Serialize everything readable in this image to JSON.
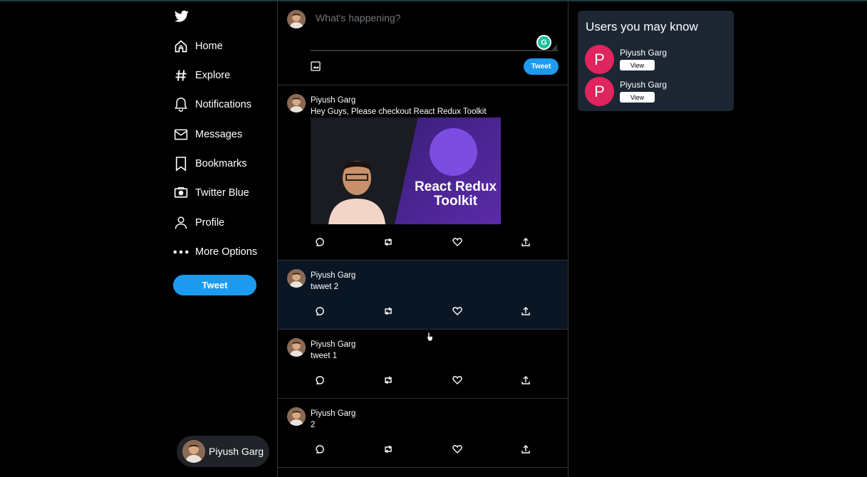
{
  "nav": {
    "items": [
      {
        "label": "Home",
        "icon": "home-icon"
      },
      {
        "label": "Explore",
        "icon": "hashtag-icon"
      },
      {
        "label": "Notifications",
        "icon": "bell-icon"
      },
      {
        "label": "Messages",
        "icon": "envelope-icon"
      },
      {
        "label": "Bookmarks",
        "icon": "bookmark-icon"
      },
      {
        "label": "Twitter Blue",
        "icon": "twitter-blue-icon"
      },
      {
        "label": "Profile",
        "icon": "user-icon"
      },
      {
        "label": "More Options",
        "icon": "more-icon"
      }
    ],
    "tweet_label": "Tweet",
    "user_name": "Piyush Garg"
  },
  "composer": {
    "placeholder": "What's happening?",
    "grammarly": "G",
    "tweet_label": "Tweet"
  },
  "feed": {
    "posts": [
      {
        "author": "Piyush Garg",
        "text": "Hey Guys, Please checkout React Redux Toolkit",
        "image_caption": "React Redux Toolkit"
      },
      {
        "author": "Piyush Garg",
        "text": "twwet 2"
      },
      {
        "author": "Piyush Garg",
        "text": "tweet 1"
      },
      {
        "author": "Piyush Garg",
        "text": "2"
      }
    ]
  },
  "suggestions": {
    "title": "Users you may know",
    "users": [
      {
        "initial": "P",
        "name": "Piyush Garg",
        "button": "View"
      },
      {
        "initial": "P",
        "name": "Piyush Garg",
        "button": "View"
      }
    ]
  },
  "colors": {
    "accent": "#1d9bf0",
    "background": "#000000",
    "panel": "#1c2733",
    "avatar_placeholder": "#e0245e",
    "border": "#2f3336"
  }
}
